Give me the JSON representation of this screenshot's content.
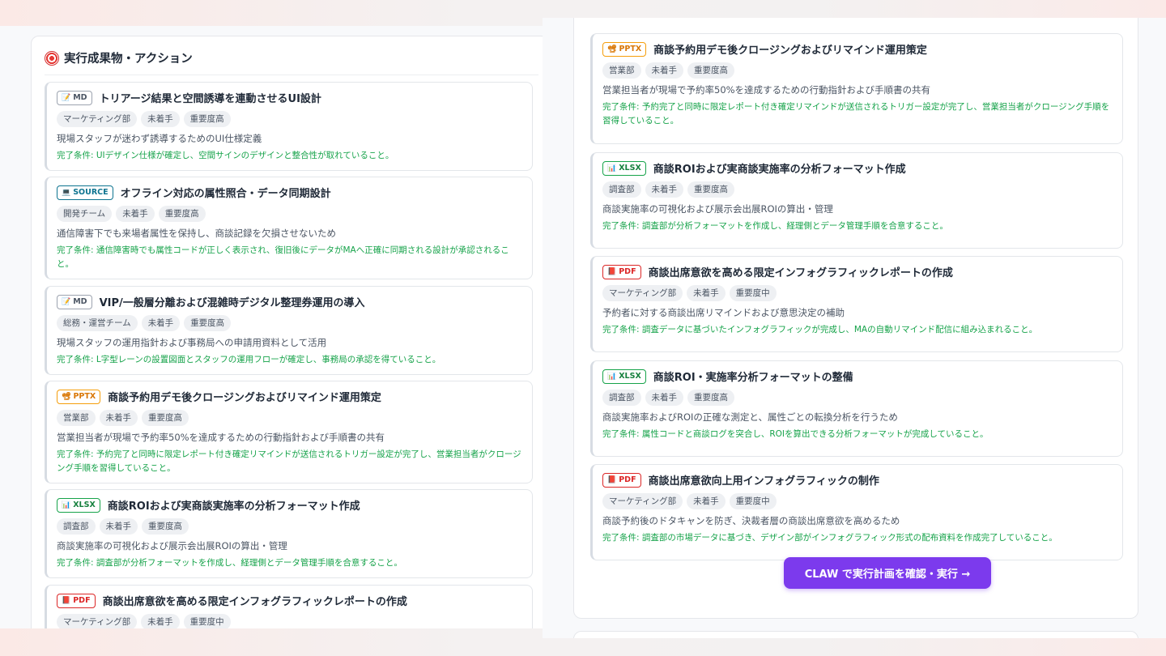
{
  "panel": {
    "title": "実行成果物・アクション"
  },
  "left_cards": [
    {
      "format": "MD",
      "format_glyph": "📝",
      "title": "トリアージ結果と空間誘導を連動させるUI設計",
      "tags": [
        "マーケティング部",
        "未着手",
        "重要度高"
      ],
      "purpose": "現場スタッフが迷わず誘導するためのUI仕様定義",
      "criteria": "完了条件: UIデザイン仕様が確定し、空間サインのデザインと整合性が取れていること。"
    },
    {
      "format": "SOURCE",
      "format_glyph": "💻",
      "title": "オフライン対応の属性照合・データ同期設計",
      "tags": [
        "開発チーム",
        "未着手",
        "重要度高"
      ],
      "purpose": "通信障害下でも来場者属性を保持し、商談記録を欠損させないため",
      "criteria": "完了条件: 通信障害時でも属性コードが正しく表示され、復旧後にデータがMAへ正確に同期される設計が承認されること。"
    },
    {
      "format": "MD",
      "format_glyph": "📝",
      "title": "VIP/一般層分離および混雑時デジタル整理券運用の導入",
      "tags": [
        "総務・運営チーム",
        "未着手",
        "重要度高"
      ],
      "purpose": "現場スタッフの運用指針および事務局への申請用資料として活用",
      "criteria": "完了条件: L字型レーンの設置図面とスタッフの運用フローが確定し、事務局の承認を得ていること。"
    },
    {
      "format": "PPTX",
      "format_glyph": "📽",
      "title": "商談予約用デモ後クロージングおよびリマインド運用策定",
      "tags": [
        "営業部",
        "未着手",
        "重要度高"
      ],
      "purpose": "営業担当者が現場で予約率50%を達成するための行動指針および手順書の共有",
      "criteria": "完了条件: 予約完了と同時に限定レポート付き確定リマインドが送信されるトリガー設定が完了し、営業担当者がクロージング手順を習得していること。"
    },
    {
      "format": "XLSX",
      "format_glyph": "📊",
      "title": "商談ROIおよび実商談実施率の分析フォーマット作成",
      "tags": [
        "調査部",
        "未着手",
        "重要度高"
      ],
      "purpose": "商談実施率の可視化および展示会出展ROIの算出・管理",
      "criteria": "完了条件: 調査部が分析フォーマットを作成し、経理側とデータ管理手順を合意すること。"
    },
    {
      "format": "PDF",
      "format_glyph": "📕",
      "title": "商談出席意欲を高める限定インフォグラフィックレポートの作成",
      "tags": [
        "マーケティング部",
        "未着手",
        "重要度中"
      ],
      "purpose": "",
      "criteria": ""
    }
  ],
  "right_cards": [
    {
      "format": "PPTX",
      "format_glyph": "📽",
      "title": "商談予約用デモ後クロージングおよびリマインド運用策定",
      "tags": [
        "営業部",
        "未着手",
        "重要度高"
      ],
      "purpose": "営業担当者が現場で予約率50%を達成するための行動指針および手順書の共有",
      "criteria": "完了条件: 予約完了と同時に限定レポート付き確定リマインドが送信されるトリガー設定が完了し、営業担当者がクロージング手順を習得していること。"
    },
    {
      "format": "XLSX",
      "format_glyph": "📊",
      "title": "商談ROIおよび実商談実施率の分析フォーマット作成",
      "tags": [
        "調査部",
        "未着手",
        "重要度高"
      ],
      "purpose": "商談実施率の可視化および展示会出展ROIの算出・管理",
      "criteria": "完了条件: 調査部が分析フォーマットを作成し、経理側とデータ管理手順を合意すること。"
    },
    {
      "format": "PDF",
      "format_glyph": "📕",
      "title": "商談出席意欲を高める限定インフォグラフィックレポートの作成",
      "tags": [
        "マーケティング部",
        "未着手",
        "重要度中"
      ],
      "purpose": "予約者に対する商談出席リマインドおよび意思決定の補助",
      "criteria": "完了条件: 調査データに基づいたインフォグラフィックが完成し、MAの自動リマインド配信に組み込まれること。"
    },
    {
      "format": "XLSX",
      "format_glyph": "📊",
      "title": "商談ROI・実施率分析フォーマットの整備",
      "tags": [
        "調査部",
        "未着手",
        "重要度高"
      ],
      "purpose": "商談実施率およびROIの正確な測定と、属性ごとの転換分析を行うため",
      "criteria": "完了条件: 属性コードと商談ログを突合し、ROIを算出できる分析フォーマットが完成していること。"
    },
    {
      "format": "PDF",
      "format_glyph": "📕",
      "title": "商談出席意欲向上用インフォグラフィックの制作",
      "tags": [
        "マーケティング部",
        "未着手",
        "重要度中"
      ],
      "purpose": "商談予約後のドタキャンを防ぎ、決裁者層の商談出席意欲を高めるため",
      "criteria": "完了条件: 調査部の市場データに基づき、デザイン部がインフォグラフィック形式の配布資料を作成完了していること。"
    }
  ],
  "cta": {
    "label": "CLAW で実行計画を確認・実行 →"
  }
}
